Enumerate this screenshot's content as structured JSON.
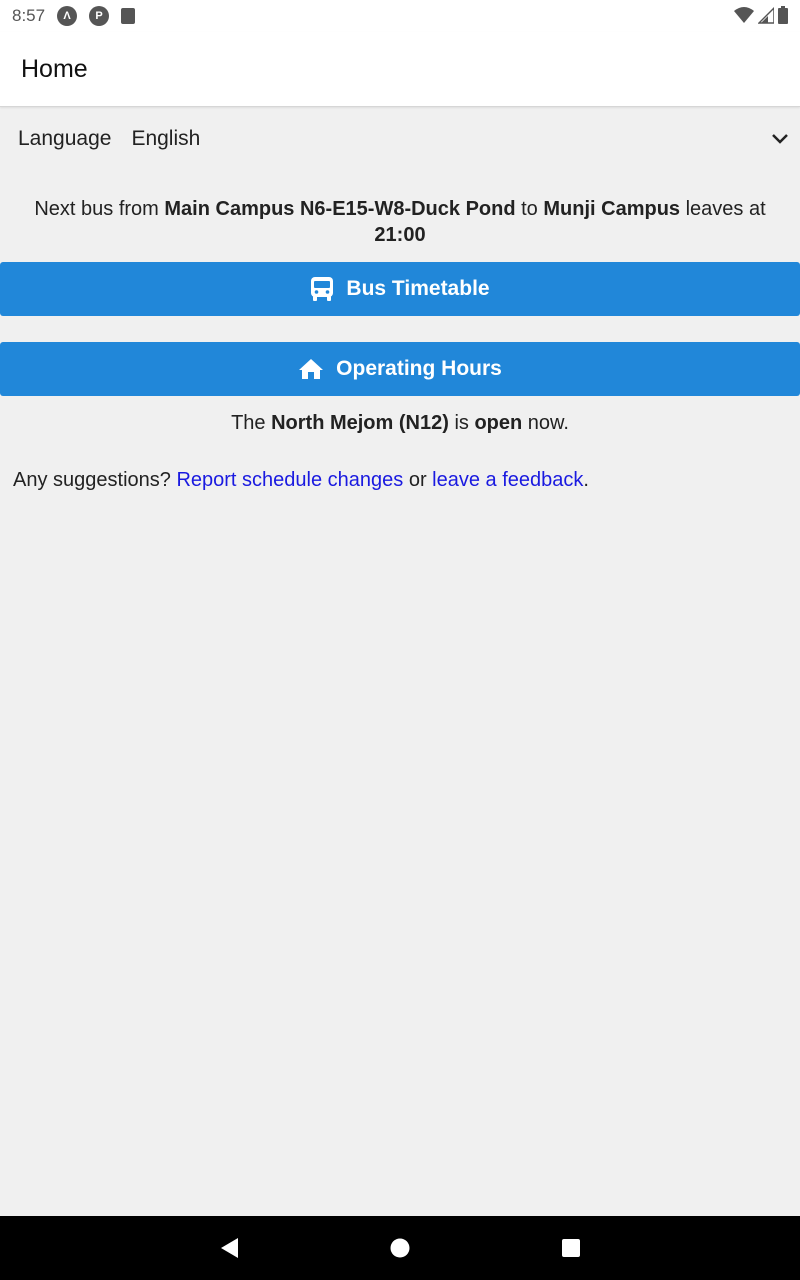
{
  "status_bar": {
    "time": "8:57"
  },
  "app_bar": {
    "title": "Home"
  },
  "language": {
    "label": "Language",
    "value": "English"
  },
  "next_bus": {
    "prefix": "Next bus from ",
    "origin": "Main Campus N6-E15-W8-Duck Pond",
    "to": " to ",
    "destination": "Munji Campus",
    "leaves_at": " leaves at ",
    "time": "21:00"
  },
  "buttons": {
    "timetable_label": "Bus Timetable",
    "hours_label": "Operating Hours"
  },
  "open_status": {
    "prefix": "The ",
    "place": "North Mejom (N12)",
    "is": " is ",
    "state": "open",
    "suffix": " now."
  },
  "suggestions": {
    "prefix": "Any suggestions? ",
    "report_link": "Report schedule changes",
    "or": " or ",
    "feedback_link": "leave a feedback",
    "suffix": "."
  },
  "icons": {
    "bus": "bus-icon",
    "home": "home-icon",
    "chevron": "chevron-down-icon"
  },
  "colors": {
    "accent": "#2187d9",
    "link": "#1a1ae0"
  }
}
